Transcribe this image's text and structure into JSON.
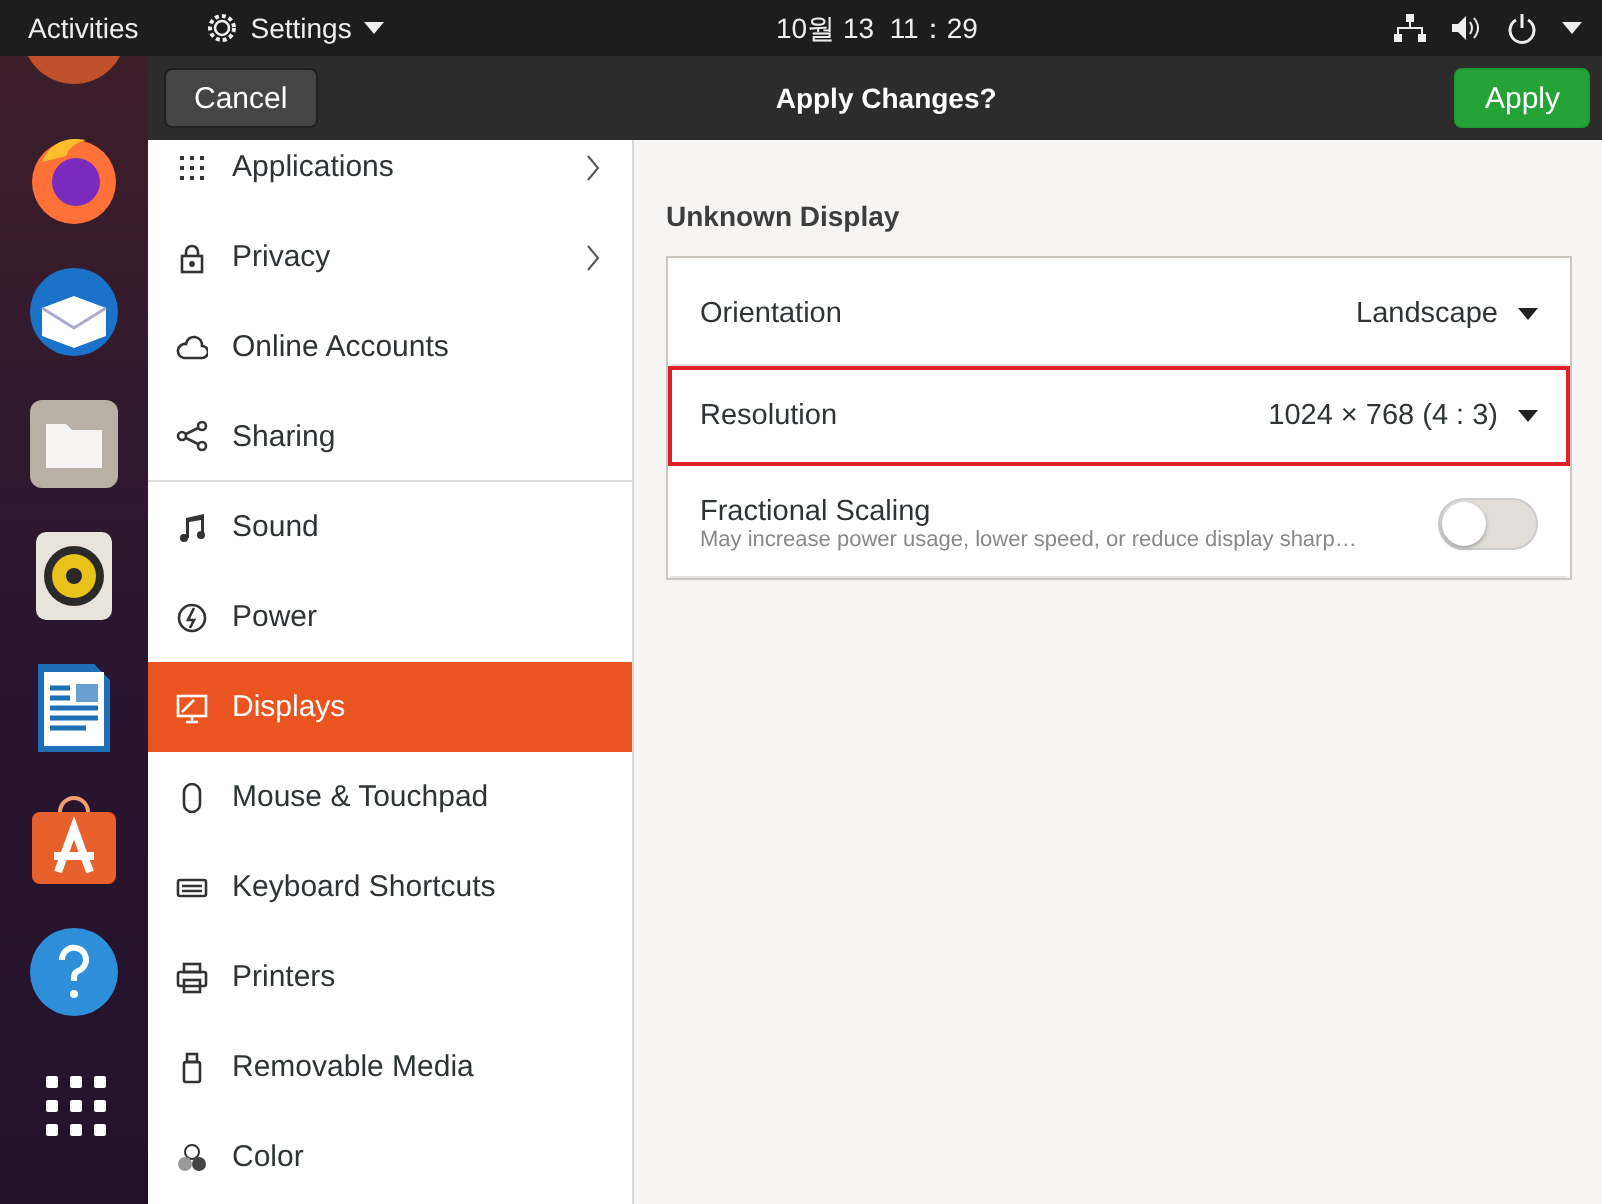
{
  "top_bar": {
    "activities": "Activities",
    "app_menu": "Settings",
    "clock": "10월 13  11：29"
  },
  "header": {
    "cancel": "Cancel",
    "title": "Apply Changes?",
    "apply": "Apply"
  },
  "dock": {
    "items": [
      {
        "kind": "partial"
      },
      {
        "kind": "firefox"
      },
      {
        "kind": "mail"
      },
      {
        "kind": "files"
      },
      {
        "kind": "speaker"
      },
      {
        "kind": "writer"
      },
      {
        "kind": "software"
      },
      {
        "kind": "help"
      },
      {
        "kind": "grid"
      }
    ]
  },
  "sidebar": {
    "items": [
      {
        "label": "Applications",
        "chevron": true,
        "selected": false,
        "divider_after": false
      },
      {
        "label": "Privacy",
        "chevron": true,
        "selected": false,
        "divider_after": false
      },
      {
        "label": "Online Accounts",
        "chevron": false,
        "selected": false,
        "divider_after": false
      },
      {
        "label": "Sharing",
        "chevron": false,
        "selected": false,
        "divider_after": true
      },
      {
        "label": "Sound",
        "chevron": false,
        "selected": false,
        "divider_after": false
      },
      {
        "label": "Power",
        "chevron": false,
        "selected": false,
        "divider_after": false
      },
      {
        "label": "Displays",
        "chevron": false,
        "selected": true,
        "divider_after": false
      },
      {
        "label": "Mouse & Touchpad",
        "chevron": false,
        "selected": false,
        "divider_after": false
      },
      {
        "label": "Keyboard Shortcuts",
        "chevron": false,
        "selected": false,
        "divider_after": false
      },
      {
        "label": "Printers",
        "chevron": false,
        "selected": false,
        "divider_after": false
      },
      {
        "label": "Removable Media",
        "chevron": false,
        "selected": false,
        "divider_after": false
      },
      {
        "label": "Color",
        "chevron": false,
        "selected": false,
        "divider_after": false
      }
    ]
  },
  "display": {
    "title": "Unknown Display",
    "rows": [
      {
        "kind": "dropdown",
        "label": "Orientation",
        "value": "Landscape",
        "highlighted": false
      },
      {
        "kind": "dropdown",
        "label": "Resolution",
        "value": "1024 × 768 (4 : 3)",
        "highlighted": true
      },
      {
        "kind": "switch",
        "label": "Fractional Scaling",
        "description": "May increase power usage, lower speed, or reduce display sharp…",
        "on": false,
        "highlighted": false
      }
    ]
  }
}
